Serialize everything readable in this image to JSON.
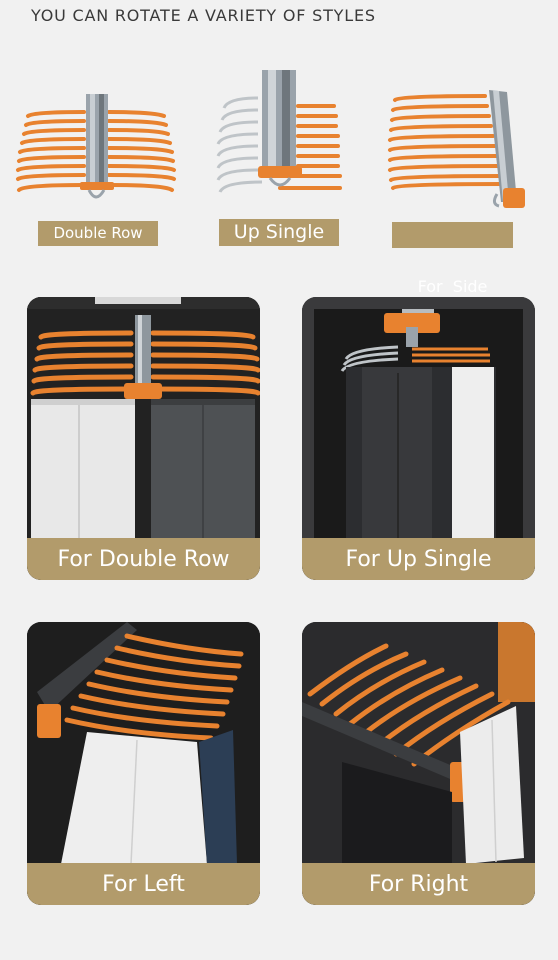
{
  "header": {
    "title": "YOU CAN ROTATE A VARIETY OF STYLES"
  },
  "styles": [
    {
      "label": "Double Row"
    },
    {
      "label": "Up Single"
    },
    {
      "label": "For  Side"
    }
  ],
  "cards": [
    {
      "caption": "For Double Row"
    },
    {
      "caption": "For Up Single"
    },
    {
      "caption": "For Left"
    },
    {
      "caption": "For Right"
    }
  ],
  "colors": {
    "background": "#f1f1f1",
    "accent_orange": "#e8822f",
    "tag_gold": "#b29b6b",
    "cabinet_dark": "#1c1c1c",
    "text_dark": "#3a3a3a"
  }
}
